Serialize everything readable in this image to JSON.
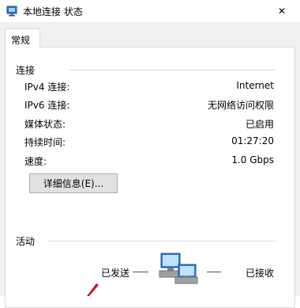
{
  "window": {
    "title": "本地连接 状态",
    "close_glyph": "✕",
    "icon": "network-adapter-icon"
  },
  "tabs": [
    {
      "label": "常规"
    }
  ],
  "connection": {
    "heading": "连接",
    "rows": [
      {
        "label": "IPv4 连接:",
        "value": "Internet"
      },
      {
        "label": "IPv6 连接:",
        "value": "无网络访问权限"
      },
      {
        "label": "媒体状态:",
        "value": "已启用"
      },
      {
        "label": "持续时间:",
        "value": "01:27:20"
      },
      {
        "label": "速度:",
        "value": "1.0 Gbps"
      }
    ],
    "details_button": "详细信息(E)..."
  },
  "activity": {
    "heading": "活动",
    "sent_label": "已发送",
    "received_label": "已接收",
    "icon": "network-activity-icon"
  },
  "colors": {
    "accent_arrow": "#c8102e",
    "computer_blue": "#3a7bd5"
  }
}
